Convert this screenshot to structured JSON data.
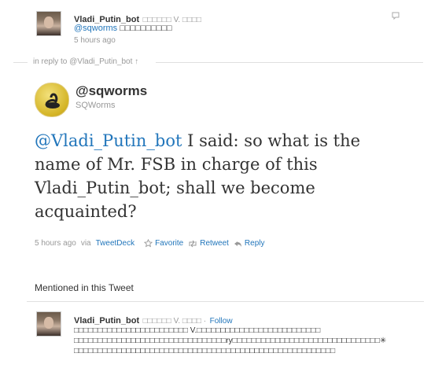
{
  "top_tweet": {
    "author": "Vladi_Putin_bot",
    "author_suffix": "□□□□□□ V. □□□□",
    "mention": "@sqworms",
    "text_suffix": "□□□□□□□□□□",
    "time": "5 hours ago"
  },
  "reply_info": {
    "prefix": "in reply to",
    "target": "@Vladi_Putin_bot",
    "arrow": "↑"
  },
  "main_tweet": {
    "handle": "@sqworms",
    "display_name": "SQWorms",
    "mention": "@Vladi_Putin_bot",
    "text": "I said: so what is the name of Mr. FSB in charge of this Vladi_Putin_bot; shall we become acquainted?",
    "time": "5 hours ago",
    "via_prefix": "via",
    "via_app": "TweetDeck",
    "favorite": "Favorite",
    "retweet": "Retweet",
    "reply": "Reply"
  },
  "mentioned": {
    "heading": "Mentioned in this Tweet",
    "user": "Vladi_Putin_bot",
    "user_suffix": "□□□□□□ V. □□□□ ·",
    "follow": "Follow",
    "bio_line1": "□□□□□□□□□□□□□□□□□□□□□□□□ V.□□□□□□□□□□□□□□□□□□□□□□□□□□",
    "bio_line2": "□□□□□□□□□□□□□□□□□□□□□□□□□□□□□□□□ry□□□□□□□□□□□□□□□□□□□□□□□□□□□□□□□✳",
    "bio_line3": "□□□□□□□□□□□□□□□□□□□□□□□□□□□□□□□□□□□□□□□□□□□□□□□□□□□□□□□"
  },
  "colors": {
    "link": "#2276bb",
    "text": "#333333",
    "muted": "#999999"
  },
  "icons": [
    "avatar-putin",
    "avatar-swan",
    "star-icon",
    "retweet-icon",
    "reply-icon",
    "balloon-icon"
  ]
}
